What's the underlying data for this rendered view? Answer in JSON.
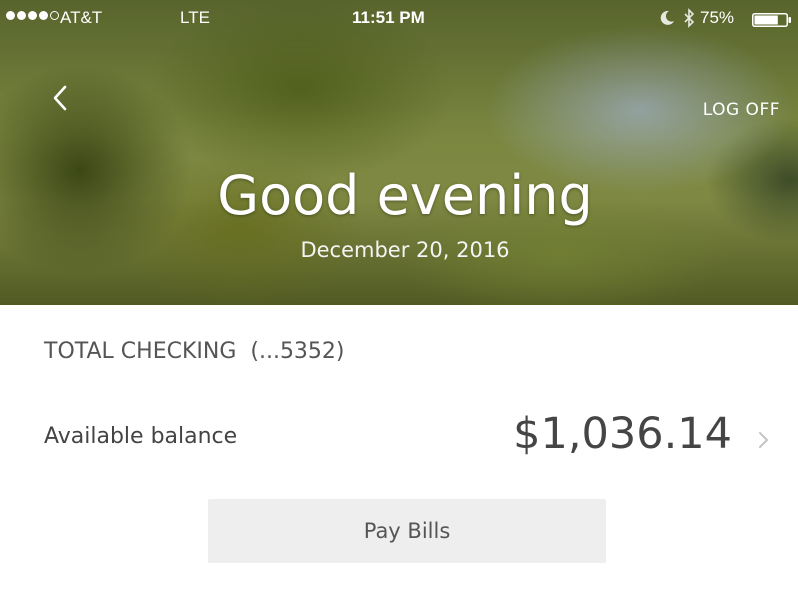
{
  "status_bar": {
    "signal_filled": 4,
    "signal_total": 5,
    "carrier": "AT&T",
    "network": "LTE",
    "time": "11:51 PM",
    "battery_percent": "75%",
    "battery_level": 0.75,
    "icons": [
      "moon-icon",
      "bluetooth-icon",
      "battery-icon"
    ]
  },
  "header": {
    "back_icon": "chevron-left-icon",
    "logoff_label": "LOG OFF",
    "greeting": "Good evening",
    "date": "December 20, 2016"
  },
  "account": {
    "name": "TOTAL CHECKING",
    "number": "(...5352)",
    "balance_label": "Available balance",
    "balance": "$1,036.14",
    "detail_icon": "chevron-right-icon"
  },
  "actions": {
    "pay_bills_label": "Pay Bills"
  },
  "colors": {
    "text_primary": "#444444",
    "button_bg": "#eeeeee",
    "header_text": "#ffffff"
  }
}
